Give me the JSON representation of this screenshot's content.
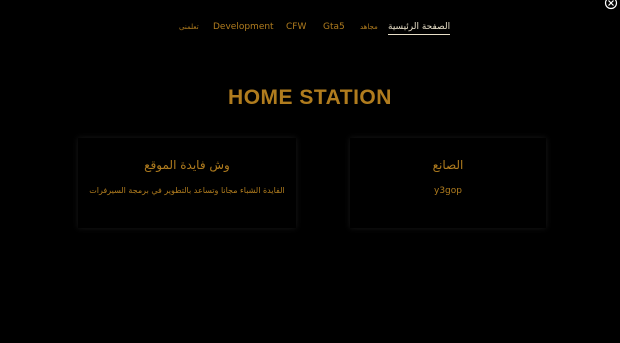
{
  "nav": {
    "items": [
      {
        "label": "تعلمنى"
      },
      {
        "label": "Development"
      },
      {
        "label": "CFW"
      },
      {
        "label": "Gta5"
      },
      {
        "label": "مجاهد"
      },
      {
        "label": "الصفحة الرئيسية"
      }
    ]
  },
  "site": {
    "title": "HOME STATION"
  },
  "cards": {
    "left": {
      "heading": "وش فايدة الموقع",
      "text": "الفايدة الشباء مجانا وتساعد بالتطوير في برمجة السيرفرات"
    },
    "right": {
      "heading": "الصانع",
      "text": "y3gop"
    }
  },
  "colors": {
    "background": "#000000",
    "accent": "#b07c1e",
    "active": "#e8dfc8"
  },
  "icons": {
    "corner": "close-icon"
  }
}
